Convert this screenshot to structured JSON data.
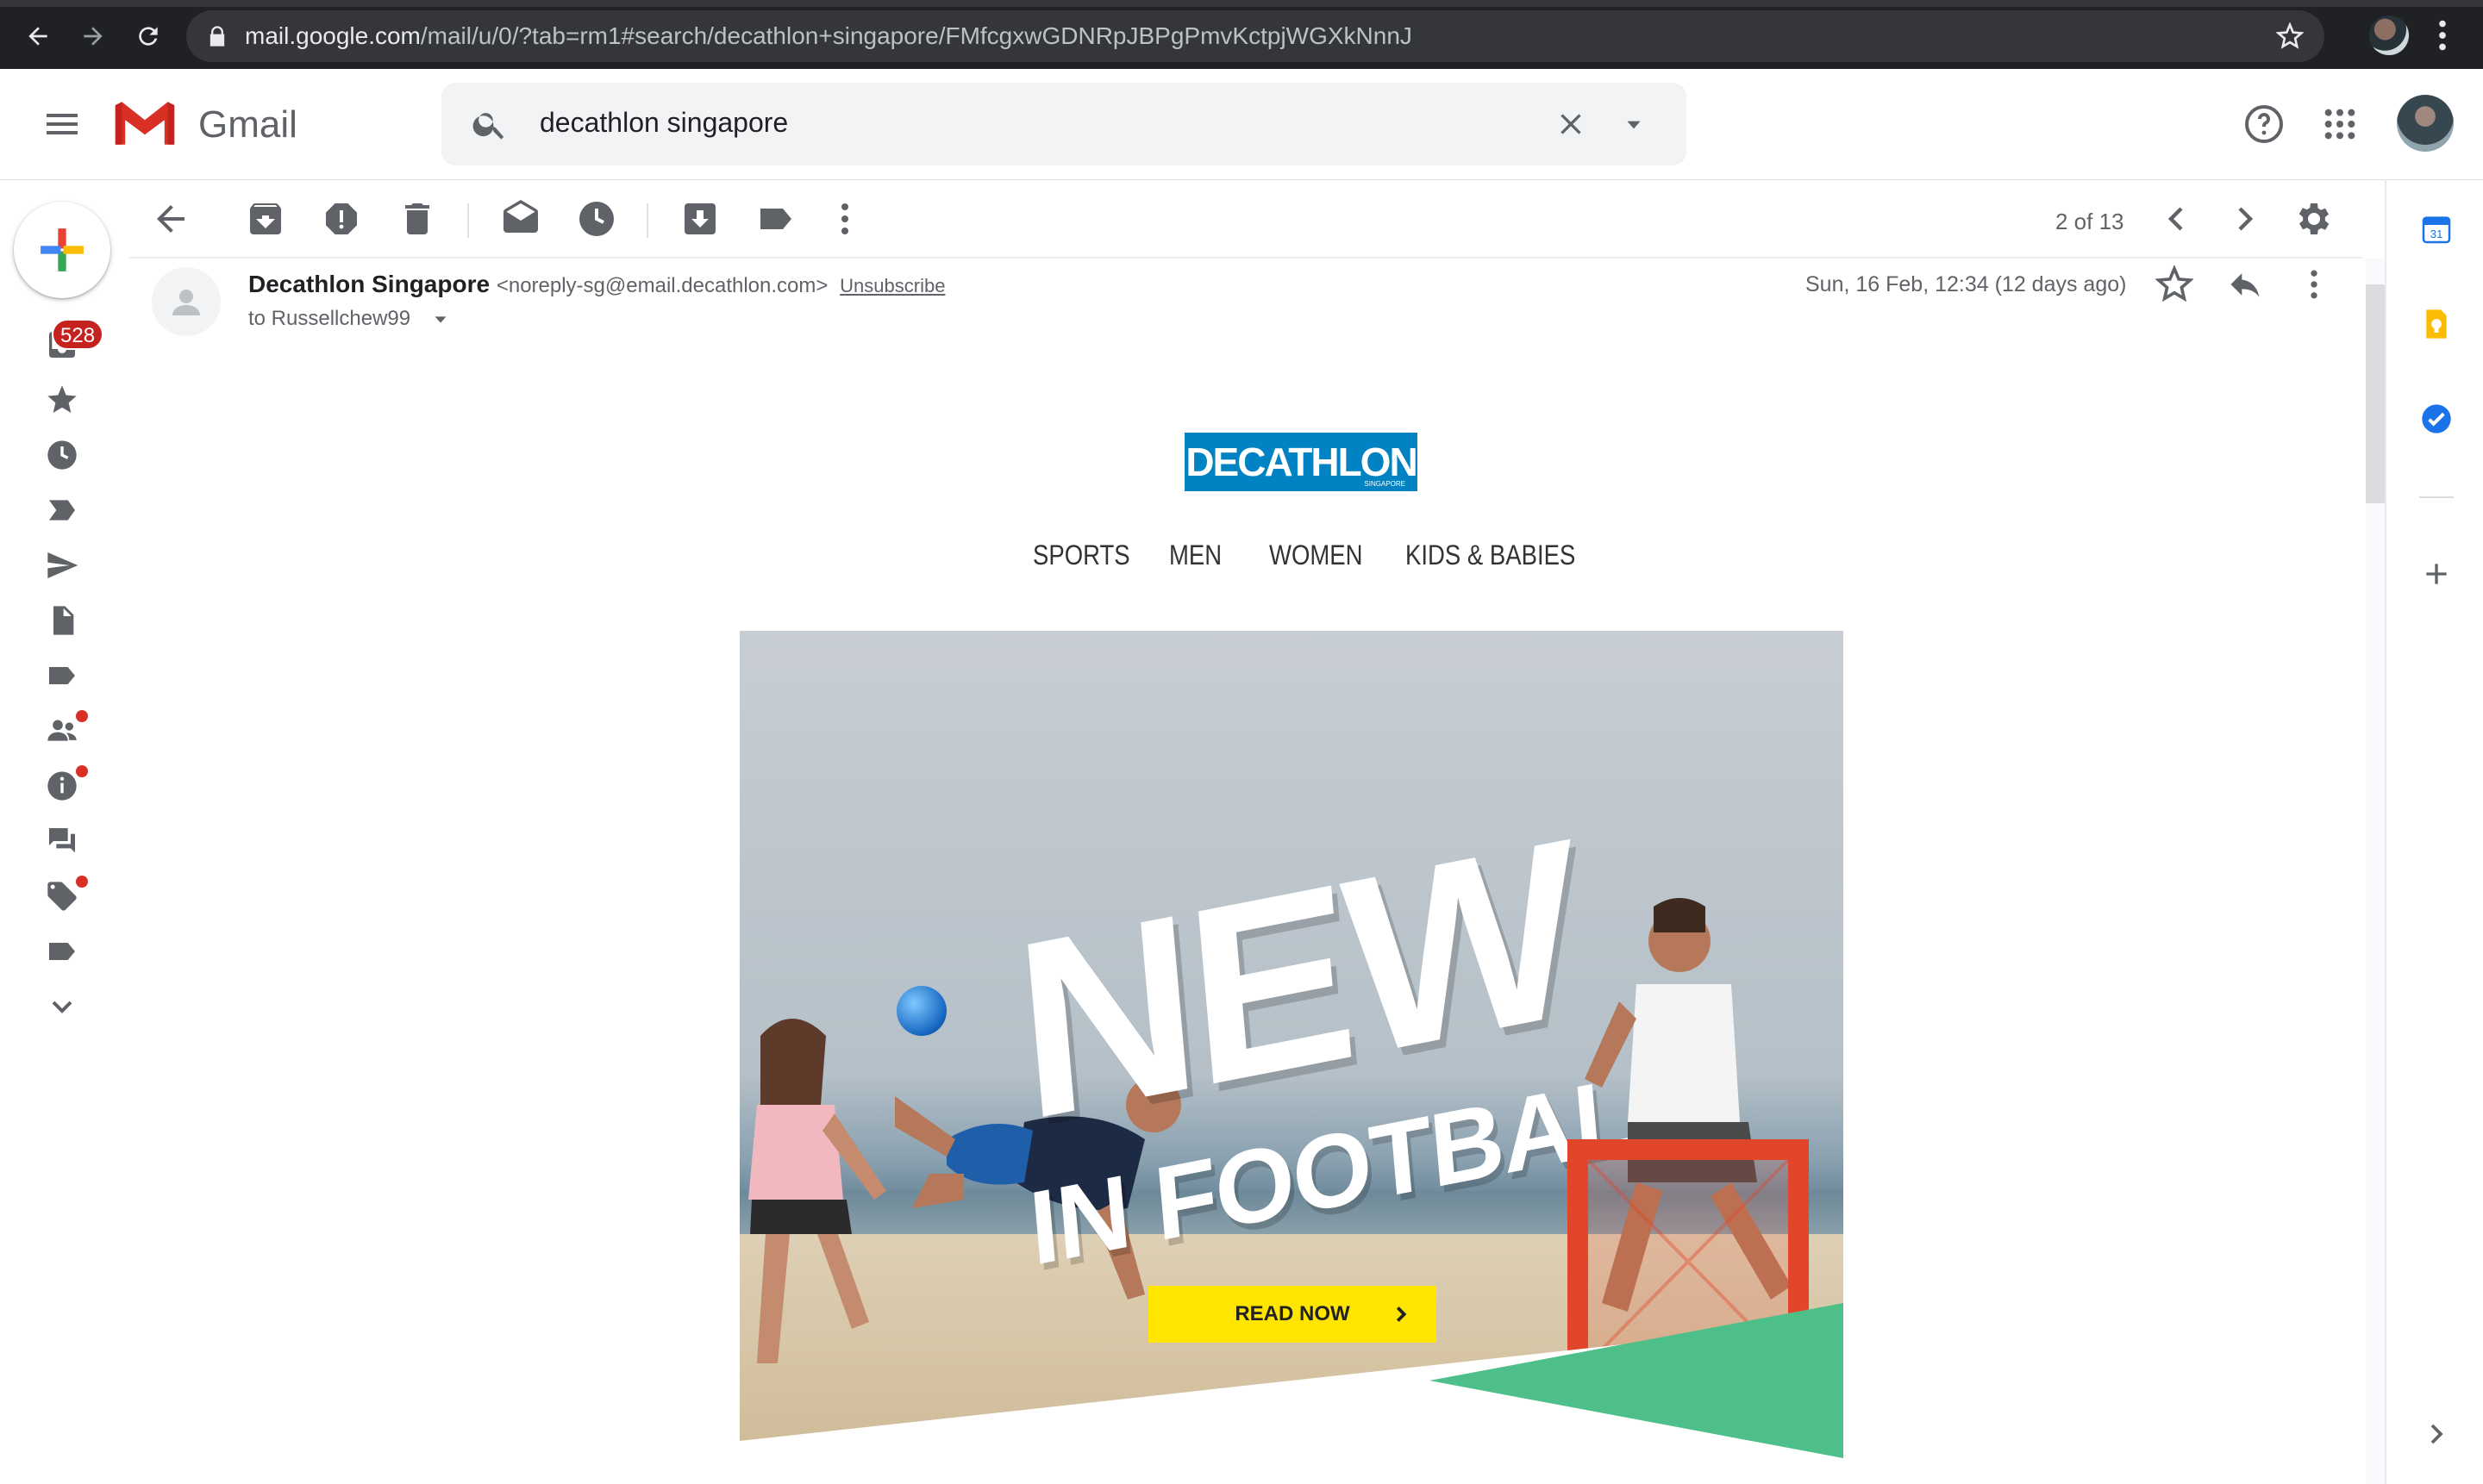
{
  "browser": {
    "url_host": "mail.google.com",
    "url_path": "/mail/u/0/?tab=rm1#search/decathlon+singapore/FMfcgxwGDNRpJBPgPmvKctpjWGXkNnnJ"
  },
  "app": {
    "name": "Gmail"
  },
  "search": {
    "query": "decathlon singapore"
  },
  "sidebar": {
    "inbox_count": "528"
  },
  "toolbar": {
    "pager": "2 of 13"
  },
  "message": {
    "sender_name": "Decathlon Singapore",
    "sender_email": "<noreply-sg@email.decathlon.com>",
    "unsubscribe": "Unsubscribe",
    "to": "to Russellchew99",
    "date": "Sun, 16 Feb, 12:34 (12 days ago)"
  },
  "email": {
    "logo": "DECATHLON",
    "logo_sub": "SINGAPORE",
    "nav": [
      "SPORTS",
      "MEN",
      "WOMEN",
      "KIDS & BABIES"
    ],
    "hero_title": "NEW",
    "hero_subtitle": "IN FOOTBALL",
    "cta": "READ NOW"
  },
  "colors": {
    "chrome_bg": "#202124",
    "decathlon_blue": "#0082c3",
    "cta_yellow": "#ffe500",
    "accent_green": "#4fbf8a",
    "badge_red": "#c5221f"
  }
}
